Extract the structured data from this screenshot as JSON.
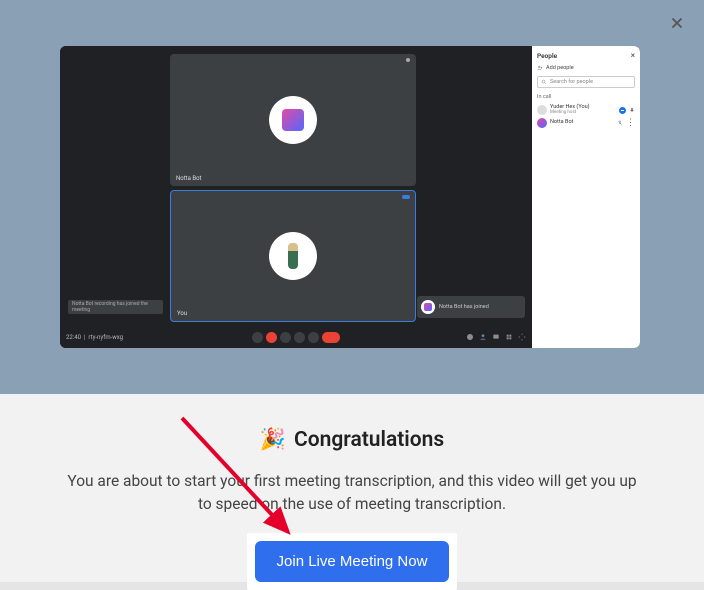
{
  "close_label": "Close",
  "meeting": {
    "tile1_label": "Notta Bot",
    "tile2_label": "You",
    "toast_left": "Notta Bot recording has joined the meeting",
    "join_toast": "Notta Bot has joined",
    "time": "22:40",
    "room": "rty-nyfm-wxg",
    "sidebar": {
      "title": "People",
      "add_people": "Add people",
      "search_placeholder": "Search for people",
      "incall": "In call",
      "participants": [
        {
          "name": "Yuder Hex (You)",
          "sub": "Meeting host"
        },
        {
          "name": "Notta Bot",
          "sub": ""
        }
      ]
    }
  },
  "congrats": {
    "emoji": "🎉",
    "title": "Congratulations",
    "subtitle": "You are about to start your first meeting transcription, and this video will get you up to speed on the use of meeting transcription.",
    "cta": "Join Live Meeting Now"
  }
}
